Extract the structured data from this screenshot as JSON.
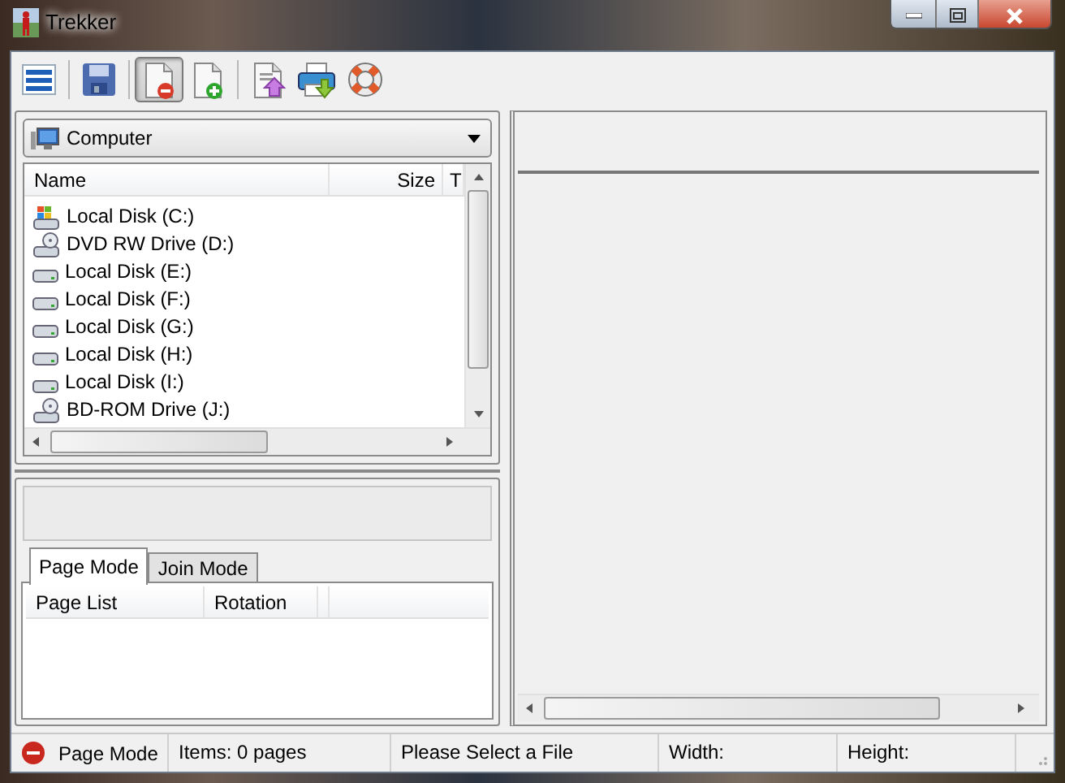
{
  "window": {
    "title": "Trekker"
  },
  "toolbar": [
    {
      "kind": "menu",
      "pressed": false
    },
    {
      "kind": "save",
      "pressed": false
    },
    {
      "kind": "remove-page",
      "pressed": true
    },
    {
      "kind": "add-page",
      "pressed": false
    },
    {
      "kind": "export",
      "pressed": false
    },
    {
      "kind": "print",
      "pressed": false
    },
    {
      "kind": "help",
      "pressed": false
    }
  ],
  "location": {
    "value": "Computer"
  },
  "file_list": {
    "columns": [
      "Name",
      "Size",
      "T"
    ],
    "rows": [
      {
        "name": "Local Disk (C:)",
        "kind": "system"
      },
      {
        "name": "DVD RW Drive (D:)",
        "kind": "optical"
      },
      {
        "name": "Local Disk (E:)",
        "kind": "disk"
      },
      {
        "name": "Local Disk (F:)",
        "kind": "disk"
      },
      {
        "name": "Local Disk (G:)",
        "kind": "disk"
      },
      {
        "name": "Local Disk (H:)",
        "kind": "disk"
      },
      {
        "name": "Local Disk (I:)",
        "kind": "disk"
      },
      {
        "name": "BD-ROM Drive (J:)",
        "kind": "optical"
      }
    ]
  },
  "tabs": [
    {
      "label": "Page Mode",
      "selected": true
    },
    {
      "label": "Join Mode",
      "selected": false
    }
  ],
  "page_list": {
    "columns": [
      "Page List",
      "Rotation"
    ]
  },
  "status_bar": {
    "mode": "Page Mode",
    "items": "Items: 0 pages",
    "message": "Please Select a File",
    "width": "Width:",
    "height": "Height:"
  }
}
